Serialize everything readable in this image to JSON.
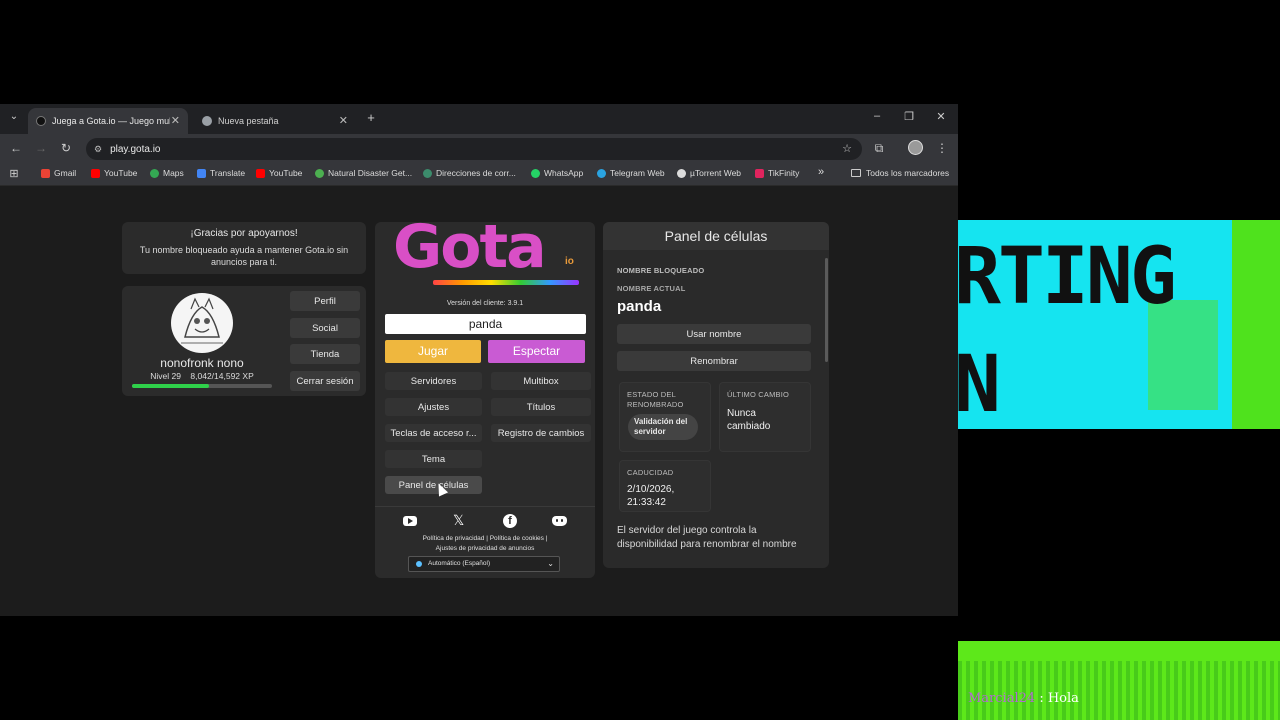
{
  "browser": {
    "tabs": [
      {
        "title": "Juega a Gota.io — Juego multijugador",
        "active": true
      },
      {
        "title": "Nueva pestaña",
        "active": false
      }
    ],
    "new_tab_symbol": "+",
    "url": "play.gota.io",
    "bookmarks": [
      {
        "label": "Gmail",
        "color": "#ea4335"
      },
      {
        "label": "YouTube",
        "color": "#ff0000"
      },
      {
        "label": "Maps",
        "color": "#34a853"
      },
      {
        "label": "Translate",
        "color": "#4285f4"
      },
      {
        "label": "YouTube",
        "color": "#ff0000"
      },
      {
        "label": "Natural Disaster Get...",
        "color": "#4caf50"
      },
      {
        "label": "Direcciones de corr...",
        "color": "#3c8c6c"
      },
      {
        "label": "WhatsApp",
        "color": "#25d366"
      },
      {
        "label": "Telegram Web",
        "color": "#2aa3e0"
      },
      {
        "label": "µTorrent Web",
        "color": "#dcdcdc"
      },
      {
        "label": "TikFinity",
        "color": "#e0245e"
      }
    ],
    "more_bookmarks": "»",
    "all_bookmarks": "Todos los marcadores"
  },
  "support_card": {
    "title": "¡Gracias por apoyarnos!",
    "text": "Tu nombre bloqueado ayuda a mantener Gota.io sin anuncios para ti."
  },
  "profile": {
    "name": "nonofronk nono",
    "level": "Nivel 29",
    "xp": "8,042/14,592 XP",
    "xp_progress": 0.551,
    "buttons": [
      "Perfil",
      "Social",
      "Tienda",
      "Cerrar sesión"
    ]
  },
  "menu": {
    "logo_text": "Gota",
    "logo_suffix": "io",
    "version": "Versión del cliente: 3.9.1",
    "name_value": "panda",
    "play": "Jugar",
    "spectate": "Espectar",
    "buttons": [
      "Servidores",
      "Multibox",
      "Ajustes",
      "Títulos",
      "Teclas de acceso r...",
      "Registro de cambios",
      "Tema",
      "Panel de células"
    ],
    "social_icons": [
      "youtube-icon",
      "x-icon",
      "facebook-icon",
      "discord-icon"
    ],
    "legal_line1": [
      "Política de privacidad",
      "Política de cookies"
    ],
    "legal_line2": "Ajustes de privacidad de anuncios",
    "language": "Automático (Español)"
  },
  "cell_panel": {
    "title": "Panel de células",
    "locked_label": "NOMBRE BLOQUEADO",
    "current_label": "NOMBRE ACTUAL",
    "current_name": "panda",
    "use_name": "Usar nombre",
    "rename": "Renombrar",
    "rename_state_label": "ESTADO DEL RENOMBRADO",
    "rename_state_value": "Validación del servidor",
    "last_change_label": "ÚLTIMO CAMBIO",
    "last_change_value": "Nunca cambiado",
    "expiry_label": "CADUCIDAD",
    "expiry_value": "2/10/2026, 21:33:42",
    "note": "El servidor del juego controla la disponibilidad para renombrar el nombre"
  },
  "overlay": {
    "line1": "RTING",
    "line2": "N",
    "chat_user": "Marcial24",
    "chat_message": "Hola"
  },
  "colors": {
    "play": "#efb73e",
    "spectate": "#c95bd3",
    "overlay_cyan": "#15e4f0",
    "overlay_green": "#5de81a"
  }
}
